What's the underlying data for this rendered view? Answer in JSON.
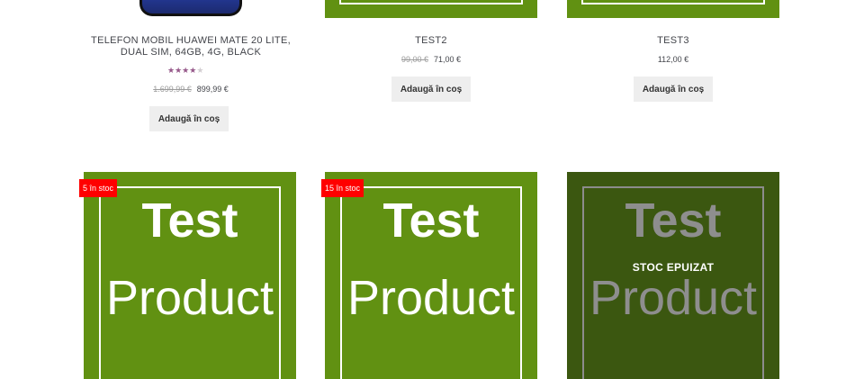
{
  "products_top": [
    {
      "title": "TELEFON MOBIL HUAWEI MATE 20 LITE, DUAL SIM, 64GB, 4G, BLACK",
      "rating": 3.5,
      "rating_max": 5,
      "old_price": "1.699,99 €",
      "price": "899,99 €",
      "button": "Adaugă în coș"
    },
    {
      "title": "TEST2",
      "old_price": "99,00 €",
      "price": "71,00 €",
      "button": "Adaugă în coș"
    },
    {
      "title": "TEST3",
      "price": "112,00 €",
      "button": "Adaugă în coș"
    }
  ],
  "products_bottom": [
    {
      "badge": "5 în stoc",
      "image_line1": "Test",
      "image_line2": "Product"
    },
    {
      "badge": "15 în stoc",
      "image_line1": "Test",
      "image_line2": "Product"
    },
    {
      "image_line1": "Test",
      "image_line2": "Product",
      "overlay": "STOC EPUIZAT"
    }
  ],
  "colors": {
    "product_green": "#619112",
    "out_of_stock_green": "#3b5710",
    "badge_red": "#ff0000",
    "star_color": "#96588a",
    "button_bg": "#eeeeee"
  }
}
